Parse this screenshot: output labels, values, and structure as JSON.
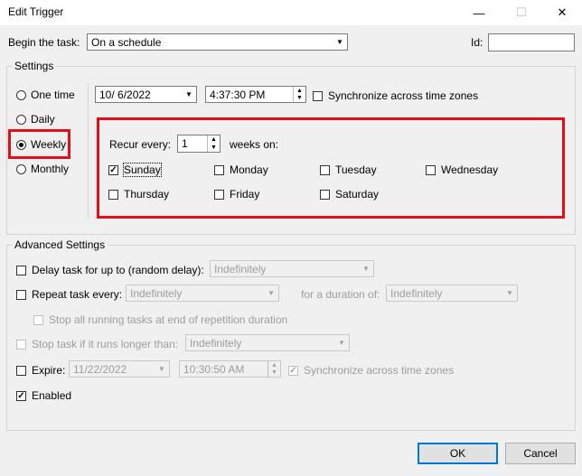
{
  "window": {
    "title": "Edit Trigger",
    "minimize_glyph": "—",
    "maximize_glyph": "☐",
    "close_glyph": "✕"
  },
  "begin": {
    "label": "Begin the task:",
    "value": "On a schedule",
    "id_label": "Id:",
    "id_value": ""
  },
  "settings": {
    "legend": "Settings",
    "radios": [
      {
        "label": "One time",
        "selected": false
      },
      {
        "label": "Daily",
        "selected": false
      },
      {
        "label": "Weekly",
        "selected": true
      },
      {
        "label": "Monthly",
        "selected": false
      }
    ],
    "start_date": "10/  6/2022",
    "start_time": "4:37:30 PM",
    "sync_label": "Synchronize across time zones"
  },
  "weekly": {
    "recur_label": "Recur every:",
    "recur_value": "1",
    "weeks_on_label": "weeks on:",
    "days": [
      {
        "label": "Sunday",
        "checked": true
      },
      {
        "label": "Monday",
        "checked": false
      },
      {
        "label": "Tuesday",
        "checked": false
      },
      {
        "label": "Wednesday",
        "checked": false
      },
      {
        "label": "Thursday",
        "checked": false
      },
      {
        "label": "Friday",
        "checked": false
      },
      {
        "label": "Saturday",
        "checked": false
      }
    ]
  },
  "advanced": {
    "legend": "Advanced Settings",
    "delay_label": "Delay task for up to (random delay):",
    "delay_value": "Indefinitely",
    "repeat_label": "Repeat task every:",
    "repeat_value": "Indefinitely",
    "duration_label": "for a duration of:",
    "duration_value": "Indefinitely",
    "stop_all_label": "Stop all running tasks at end of repetition duration",
    "stop_longer_label": "Stop task if it runs longer than:",
    "stop_longer_value": "Indefinitely",
    "expire_label": "Expire:",
    "expire_date": "11/22/2022",
    "expire_time": "10:30:50 AM",
    "expire_sync_label": "Synchronize across time zones",
    "enabled_label": "Enabled"
  },
  "buttons": {
    "ok": "OK",
    "cancel": "Cancel"
  },
  "colors": {
    "highlight": "#e2101b",
    "default_button_border": "#0078d7"
  }
}
